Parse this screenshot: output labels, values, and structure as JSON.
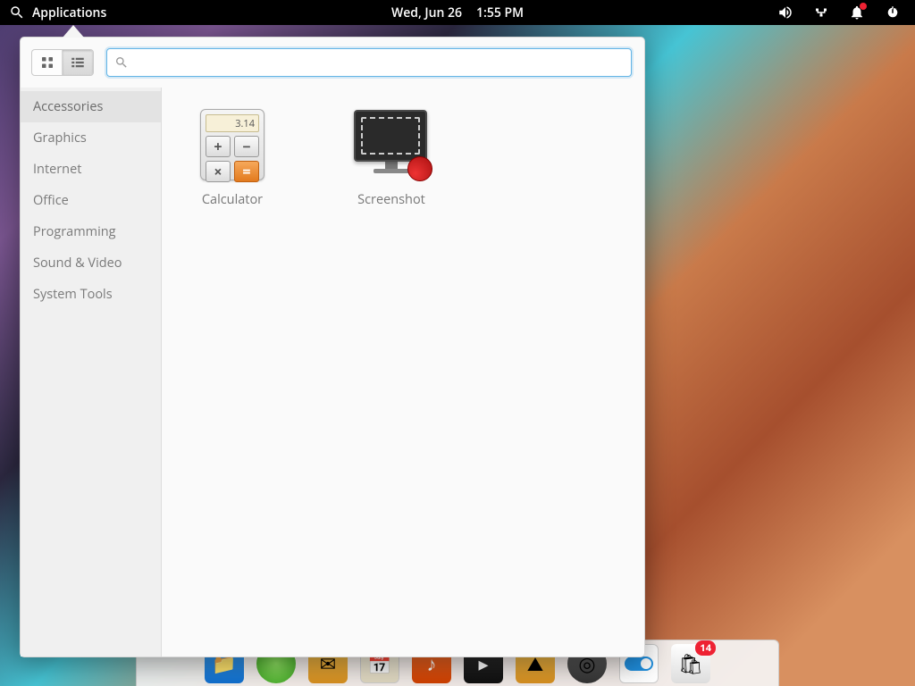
{
  "panel": {
    "applications_label": "Applications",
    "date": "Wed, Jun 26",
    "time": "1:55 PM"
  },
  "menu": {
    "search_placeholder": "",
    "categories": [
      "Accessories",
      "Graphics",
      "Internet",
      "Office",
      "Programming",
      "Sound & Video",
      "System Tools"
    ],
    "apps": [
      {
        "name": "Calculator"
      },
      {
        "name": "Screenshot"
      }
    ],
    "calc_display": "3.14"
  },
  "dock": {
    "update_badge": "14"
  }
}
